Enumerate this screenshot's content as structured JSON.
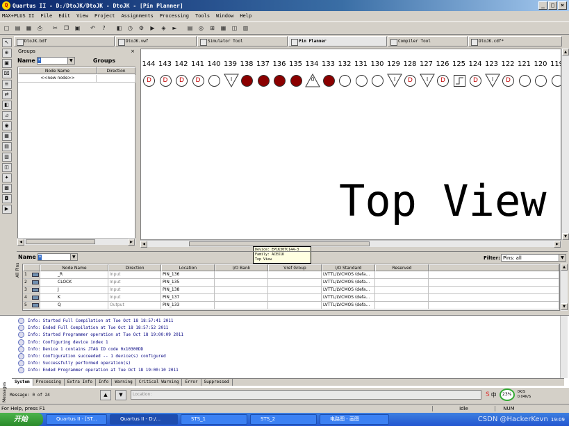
{
  "window": {
    "title": "Quartus II - D:/DtoJK/DtoJK - DtoJK - [Pin Planner]",
    "logo": "Q"
  },
  "menu": [
    "MAX+PLUS II",
    "File",
    "Edit",
    "View",
    "Project",
    "Assignments",
    "Processing",
    "Tools",
    "Window",
    "Help"
  ],
  "toolbar_icons": [
    "new-icon",
    "open-icon",
    "save-icon",
    "print-icon",
    "cut-icon",
    "copy-icon",
    "paste-icon",
    "undo-icon",
    "help-pointer-icon",
    "assign-icon",
    "timing-icon",
    "settings-icon",
    "compile-icon",
    "analyze-icon",
    "start-icon",
    "report-icon",
    "programmer-icon",
    "pinplanner-icon",
    "chip-icon",
    "netlist-icon",
    "floorplan-icon"
  ],
  "tabs": [
    {
      "label": "DtoJK.bdf"
    },
    {
      "label": "DtoJK.vwf"
    },
    {
      "label": "Simulator Tool"
    },
    {
      "label": "Pin Planner"
    },
    {
      "label": "Compiler Tool"
    },
    {
      "label": "DtoJK.cdf*"
    }
  ],
  "groups": {
    "title": "Groups",
    "name_label": "Name",
    "name_value": "*",
    "groups_label": "Groups",
    "columns": [
      "Node Name",
      "Direction"
    ],
    "new_node": "<<new node>>"
  },
  "pins": [
    {
      "num": "144",
      "type": "D"
    },
    {
      "num": "143",
      "type": "D"
    },
    {
      "num": "142",
      "type": "D"
    },
    {
      "num": "141",
      "type": "D"
    },
    {
      "num": "140",
      "type": "O"
    },
    {
      "num": "139",
      "type": "I"
    },
    {
      "num": "138",
      "type": "dark"
    },
    {
      "num": "137",
      "type": "dark"
    },
    {
      "num": "136",
      "type": "dark"
    },
    {
      "num": "135",
      "type": "dark"
    },
    {
      "num": "134",
      "type": "0"
    },
    {
      "num": "133",
      "type": "dark"
    },
    {
      "num": "132",
      "type": "O"
    },
    {
      "num": "131",
      "type": "O"
    },
    {
      "num": "130",
      "type": "O"
    },
    {
      "num": "129",
      "type": "I"
    },
    {
      "num": "128",
      "type": "D"
    },
    {
      "num": "127",
      "type": "I"
    },
    {
      "num": "126",
      "type": "D"
    },
    {
      "num": "125",
      "type": "sq"
    },
    {
      "num": "124",
      "type": "D"
    },
    {
      "num": "123",
      "type": "I"
    },
    {
      "num": "122",
      "type": "D"
    },
    {
      "num": "121",
      "type": "O"
    },
    {
      "num": "120",
      "type": "O"
    },
    {
      "num": "119",
      "type": "O"
    }
  ],
  "top_view": "Top View",
  "tooltip": [
    "Device: EP1K30TC144-3",
    "Family: ACEX1K",
    "Top View"
  ],
  "nodes": {
    "name_label": "Name",
    "name_value": "*",
    "filter_label": "Filter:",
    "filter_value": "Pins: all",
    "side_label": "All Pins",
    "columns": [
      "Node Name",
      "Direction",
      "Location",
      "I/O Bank",
      "Vref Group",
      "I/O Standard",
      "Reserved",
      "Group"
    ],
    "rows": [
      {
        "n": "1",
        "name": "_R",
        "dir": "Input",
        "loc": "PIN_136",
        "std": "LVTTL/LVCMOS (defa..."
      },
      {
        "n": "2",
        "name": "CLOCK",
        "dir": "Input",
        "loc": "PIN_135",
        "std": "LVTTL/LVCMOS (defa..."
      },
      {
        "n": "3",
        "name": "J",
        "dir": "Input",
        "loc": "PIN_138",
        "std": "LVTTL/LVCMOS (defa..."
      },
      {
        "n": "4",
        "name": "K",
        "dir": "Input",
        "loc": "PIN_137",
        "std": "LVTTL/LVCMOS (defa..."
      },
      {
        "n": "5",
        "name": "Q",
        "dir": "Output",
        "loc": "PIN_133",
        "std": "LVTTL/LVCMOS (defa..."
      }
    ]
  },
  "messages": [
    "Info: Started Full Compilation at Tue Oct 18 18:57:41 2011",
    "Info: Ended Full Compilation at Tue Oct 18 18:57:52 2011",
    "Info: Started Programmer operation at Tue Oct 18 19:00:09 2011",
    "Info: Configuring device index 1",
    "Info: Device 1 contains JTAG ID code 0x10300DD",
    "Info: Configuration succeeded -- 1 device(s) configured",
    "Info: Successfully performed operation(s)",
    "Info: Ended Programmer operation at Tue Oct 18 19:00:10 2011"
  ],
  "msg_tabs": [
    "System",
    "Processing",
    "Extra Info",
    "Info",
    "Warning",
    "Critical Warning",
    "Error",
    "Suppressed"
  ],
  "msg_side": "Messages",
  "msg_bar": {
    "message": "Message: 0 of 24",
    "location_placeholder": "Location:"
  },
  "net": {
    "percent": "23%",
    "up": "0K/S",
    "down": "0.04K/S"
  },
  "status": {
    "help": "For Help, press F1",
    "idle": "Idle",
    "num": "NUM"
  },
  "taskbar": {
    "start": "开始",
    "tasks": [
      "Quartus II - [ST...",
      "Quartus II - D:/...",
      "STS_1",
      "STS_2",
      "电路图 - 画图"
    ],
    "clock": "19:09",
    "watermark": "CSDN @HackerKevn"
  },
  "colors": {
    "pin_red": "#c00000",
    "pin_dark": "#8b0000",
    "title_blue": "#0a246a"
  }
}
